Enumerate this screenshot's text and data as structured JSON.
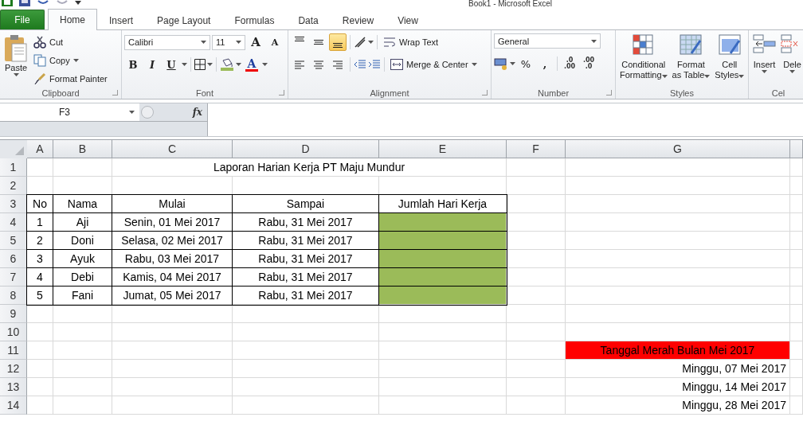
{
  "window": {
    "title": "Book1  -  Microsoft Excel"
  },
  "ribbon_tabs": [
    {
      "label": "File",
      "kind": "file",
      "selected": false
    },
    {
      "label": "Home",
      "kind": "tab",
      "selected": true
    },
    {
      "label": "Insert",
      "kind": "tab",
      "selected": false
    },
    {
      "label": "Page Layout",
      "kind": "tab",
      "selected": false
    },
    {
      "label": "Formulas",
      "kind": "tab",
      "selected": false
    },
    {
      "label": "Data",
      "kind": "tab",
      "selected": false
    },
    {
      "label": "Review",
      "kind": "tab",
      "selected": false
    },
    {
      "label": "View",
      "kind": "tab",
      "selected": false
    }
  ],
  "clipboard": {
    "label": "Clipboard",
    "paste": "Paste",
    "cut": "Cut",
    "copy": "Copy",
    "format_painter": "Format Painter"
  },
  "font": {
    "label": "Font",
    "font_name": "Calibri",
    "font_size": "11",
    "grow": "A",
    "shrink": "A",
    "bold": "B",
    "italic": "I",
    "underline": "U",
    "font_color": "A"
  },
  "alignment": {
    "label": "Alignment",
    "vertical": [
      {
        "kind": "top",
        "selected": false
      },
      {
        "kind": "middle",
        "selected": false
      },
      {
        "kind": "bottom",
        "selected": true
      }
    ],
    "wrap_text": "Wrap Text",
    "merge_center": "Merge & Center"
  },
  "number": {
    "label": "Number",
    "format": "General",
    "percent": "%",
    "comma": ",",
    "increase_decimal": [
      ".0",
      ".00"
    ],
    "decrease_decimal": [
      ".00",
      ".0"
    ]
  },
  "styles": {
    "label": "Styles",
    "buttons": [
      {
        "kind": "conditional",
        "lines": [
          "Conditional",
          "Formatting"
        ]
      },
      {
        "kind": "table",
        "lines": [
          "Format",
          "as Table"
        ]
      },
      {
        "kind": "cell",
        "lines": [
          "Cell",
          "Styles"
        ]
      }
    ]
  },
  "cells": {
    "label": "Cel",
    "buttons": [
      {
        "kind": "insert",
        "label": "Insert"
      },
      {
        "kind": "delete",
        "label": "Dele"
      }
    ]
  },
  "formula_bar": {
    "name_box": "F3",
    "fx": "fx"
  },
  "sheet": {
    "columns": [
      "A",
      "B",
      "C",
      "D",
      "E",
      "F",
      "G"
    ],
    "rows": [
      {
        "number": "1",
        "cells": [
          "",
          "",
          "",
          {
            "text": "Laporan Harian Kerja PT Maju Mundur",
            "kind": "overflow",
            "bordered": false
          },
          "",
          "",
          ""
        ]
      },
      {
        "number": "2",
        "cells": [
          "",
          "",
          "",
          "",
          "",
          "",
          ""
        ]
      },
      {
        "number": "3",
        "cells": [
          {
            "text": "No",
            "bordered": true
          },
          {
            "text": "Nama",
            "bordered": true
          },
          {
            "text": "Mulai",
            "bordered": true
          },
          {
            "text": "Sampai",
            "bordered": true
          },
          {
            "text": "Jumlah Hari Kerja",
            "bordered": true
          },
          "",
          ""
        ]
      },
      {
        "number": "4",
        "cells": [
          {
            "text": "1",
            "bordered": true
          },
          {
            "text": "Aji",
            "bordered": true
          },
          {
            "text": "Senin, 01 Mei 2017",
            "bordered": true
          },
          {
            "text": "Rabu, 31 Mei 2017",
            "bordered": true
          },
          {
            "bordered": true,
            "color": "#9bbb59"
          },
          "",
          ""
        ]
      },
      {
        "number": "5",
        "cells": [
          {
            "text": "2",
            "bordered": true
          },
          {
            "text": "Doni",
            "bordered": true
          },
          {
            "text": "Selasa, 02 Mei 2017",
            "bordered": true
          },
          {
            "text": "Rabu, 31 Mei 2017",
            "bordered": true
          },
          {
            "bordered": true,
            "color": "#9bbb59"
          },
          "",
          ""
        ]
      },
      {
        "number": "6",
        "cells": [
          {
            "text": "3",
            "bordered": true
          },
          {
            "text": "Ayuk",
            "bordered": true
          },
          {
            "text": "Rabu, 03 Mei 2017",
            "bordered": true
          },
          {
            "text": "Rabu, 31 Mei 2017",
            "bordered": true
          },
          {
            "bordered": true,
            "color": "#9bbb59"
          },
          "",
          ""
        ]
      },
      {
        "number": "7",
        "cells": [
          {
            "text": "4",
            "bordered": true
          },
          {
            "text": "Debi",
            "bordered": true
          },
          {
            "text": "Kamis, 04 Mei 2017",
            "bordered": true
          },
          {
            "text": "Rabu, 31 Mei 2017",
            "bordered": true
          },
          {
            "bordered": true,
            "color": "#9bbb59"
          },
          "",
          ""
        ]
      },
      {
        "number": "8",
        "cells": [
          {
            "text": "5",
            "bordered": true
          },
          {
            "text": "Fani",
            "bordered": true
          },
          {
            "text": "Jumat, 05 Mei 2017",
            "bordered": true
          },
          {
            "text": "Rabu, 31 Mei 2017",
            "bordered": true
          },
          {
            "bordered": true,
            "color": "#9bbb59"
          },
          "",
          ""
        ]
      },
      {
        "number": "9",
        "cells": [
          "",
          "",
          "",
          "",
          "",
          "",
          ""
        ]
      },
      {
        "number": "10",
        "cells": [
          "",
          "",
          "",
          "",
          "",
          "",
          ""
        ]
      },
      {
        "number": "11",
        "cells": [
          "",
          "",
          "",
          "",
          "",
          "",
          {
            "text": "Tanggal Merah Bulan Mei 2017",
            "bordered": false,
            "color": "#ff0000"
          }
        ]
      },
      {
        "number": "12",
        "cells": [
          "",
          "",
          "",
          "",
          "",
          "",
          {
            "text": "Minggu, 07 Mei 2017",
            "kind": "right",
            "bordered": false
          }
        ]
      },
      {
        "number": "13",
        "cells": [
          "",
          "",
          "",
          "",
          "",
          "",
          {
            "text": "Minggu, 14 Mei 2017",
            "kind": "right",
            "bordered": false
          }
        ]
      },
      {
        "number": "14",
        "cells": [
          "",
          "",
          "",
          "",
          "",
          "",
          {
            "text": "Minggu, 28 Mei 2017",
            "kind": "right",
            "bordered": false
          }
        ]
      }
    ]
  }
}
